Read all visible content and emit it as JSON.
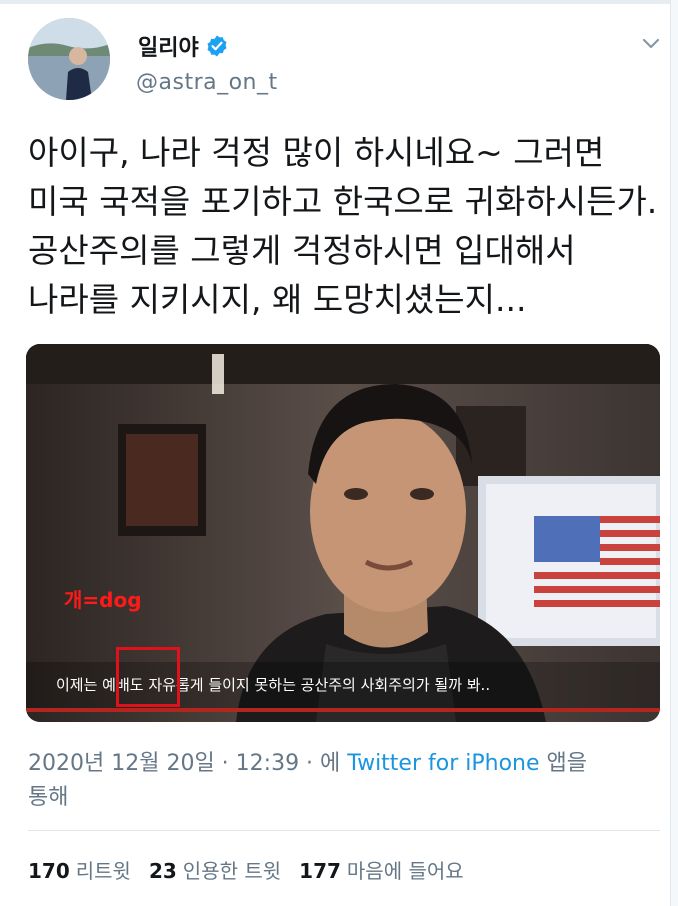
{
  "tweet": {
    "display_name": "일리야",
    "handle": "@astra_on_t",
    "text_lines": [
      "아이구, 나라 걱정 많이 하시네요~ 그러면",
      "미국 국적을 포기하고 한국으로 귀화하시든가.",
      "공산주의를 그렇게 걱정하시면 입대해서",
      "나라를 지키시지, 왜 도망치셨는지..."
    ],
    "media": {
      "overlay_label": "개=dog",
      "subtitle_before": "이제는 ",
      "subtitle_highlight": "예배도",
      "subtitle_after": " 자유롭게 들이지 못하는  공산주의 사회주의가 될까 봐.."
    },
    "meta": {
      "date": "2020년 12월 20일 · 12:39 · 에 ",
      "source": "Twitter for iPhone",
      "suffix": " 앱을",
      "line2": "통해"
    },
    "stats": {
      "retweets": "170",
      "retweets_label": "리트윗",
      "quotes": "23",
      "quotes_label": "인용한 트윗",
      "likes": "177",
      "likes_label": "마음에 들어요"
    }
  },
  "colors": {
    "verified": "#1da1f2",
    "link": "#1b95e0",
    "secondary_text": "#657786",
    "highlight_red": "#e0111b"
  }
}
